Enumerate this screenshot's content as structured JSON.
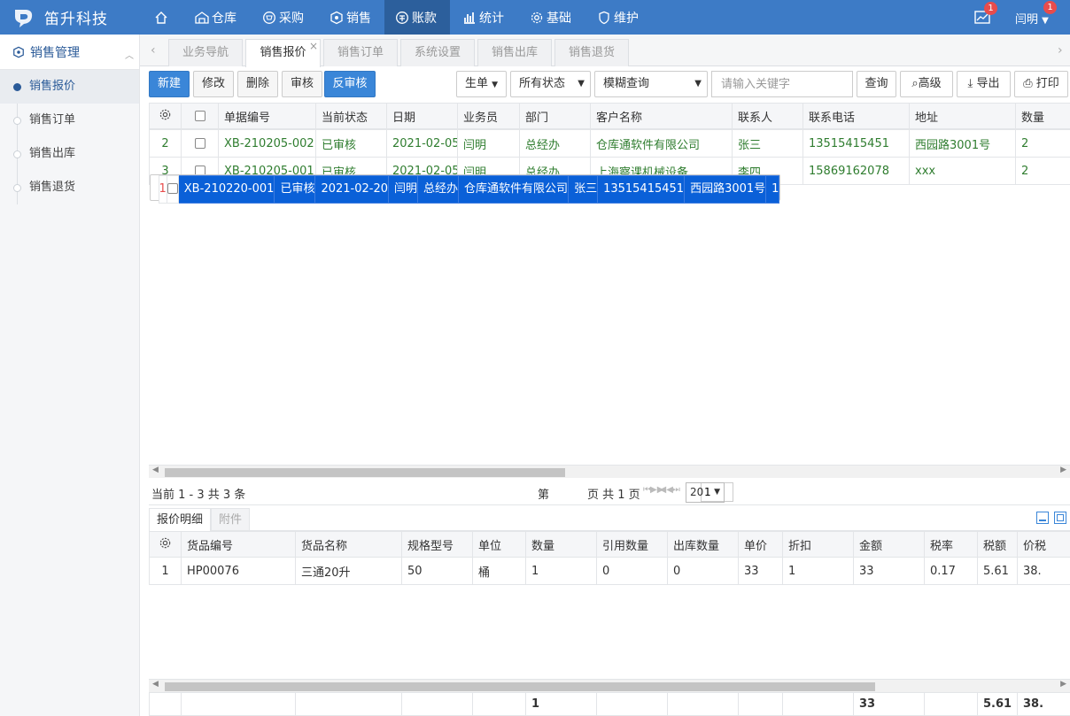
{
  "app": {
    "title": "笛升科技"
  },
  "nav": [
    {
      "label": "",
      "icon": "home-icon"
    },
    {
      "label": "仓库",
      "icon": "warehouse-icon"
    },
    {
      "label": "采购",
      "icon": "purchase-icon"
    },
    {
      "label": "销售",
      "icon": "sales-icon"
    },
    {
      "label": "账款",
      "icon": "account-icon"
    },
    {
      "label": "统计",
      "icon": "chart-icon"
    },
    {
      "label": "基础",
      "icon": "gear-icon"
    },
    {
      "label": "维护",
      "icon": "maintain-icon"
    }
  ],
  "header": {
    "notif_count": "1",
    "user_name": "闫明",
    "user_badge": "1"
  },
  "sidebar": {
    "title": "销售管理",
    "items": [
      {
        "label": "销售报价"
      },
      {
        "label": "销售订单"
      },
      {
        "label": "销售出库"
      },
      {
        "label": "销售退货"
      }
    ]
  },
  "tabs": [
    {
      "label": "业务导航"
    },
    {
      "label": "销售报价"
    },
    {
      "label": "销售订单"
    },
    {
      "label": "系统设置"
    },
    {
      "label": "销售出库"
    },
    {
      "label": "销售退货"
    }
  ],
  "toolbar": {
    "new": "新建",
    "edit": "修改",
    "delete": "删除",
    "audit": "审核",
    "unaudit": "反审核",
    "gen": "生单",
    "status": "所有状态",
    "mode": "模糊查询",
    "kw_placeholder": "请输入关键字",
    "query": "查询",
    "advanced": "高级",
    "export": "导出",
    "print": "打印"
  },
  "grid": {
    "columns": [
      "单据编号",
      "当前状态",
      "日期",
      "业务员",
      "部门",
      "客户名称",
      "联系人",
      "联系电话",
      "地址",
      "数量"
    ],
    "rows": [
      {
        "n": "1",
        "cells": [
          "XB-210220-001",
          "已审核",
          "2021-02-20",
          "闫明",
          "总经办",
          "仓库通软件有限公司",
          "张三",
          "13515415451",
          "西园路3001号",
          "1"
        ]
      },
      {
        "n": "2",
        "cells": [
          "XB-210205-002",
          "已审核",
          "2021-02-05",
          "闫明",
          "总经办",
          "仓库通软件有限公司",
          "张三",
          "13515415451",
          "西园路3001号",
          "2"
        ]
      },
      {
        "n": "3",
        "cells": [
          "XB-210205-001",
          "已审核",
          "2021-02-05",
          "闫明",
          "总经办",
          "上海察课机械设备",
          "李四",
          "15869162078",
          "xxx",
          "2"
        ]
      }
    ]
  },
  "pager": {
    "info": "当前 1 - 3 共 3 条",
    "page_pre": "第",
    "page": "1",
    "page_post": "页 共 1 页",
    "size": "20"
  },
  "detail": {
    "tabs": [
      "报价明细",
      "附件"
    ],
    "columns": [
      "货品编号",
      "货品名称",
      "规格型号",
      "单位",
      "数量",
      "引用数量",
      "出库数量",
      "单价",
      "折扣",
      "金额",
      "税率",
      "税额",
      "价税"
    ],
    "rows": [
      {
        "n": "1",
        "cells": [
          "HP00076",
          "三通20升",
          "50",
          "桶",
          "1",
          "0",
          "0",
          "33",
          "1",
          "33",
          "0.17",
          "5.61",
          "38."
        ]
      }
    ],
    "totals": [
      "",
      "",
      "",
      "",
      "1",
      "",
      "",
      "",
      "",
      "33",
      "",
      "5.61",
      "38."
    ]
  }
}
